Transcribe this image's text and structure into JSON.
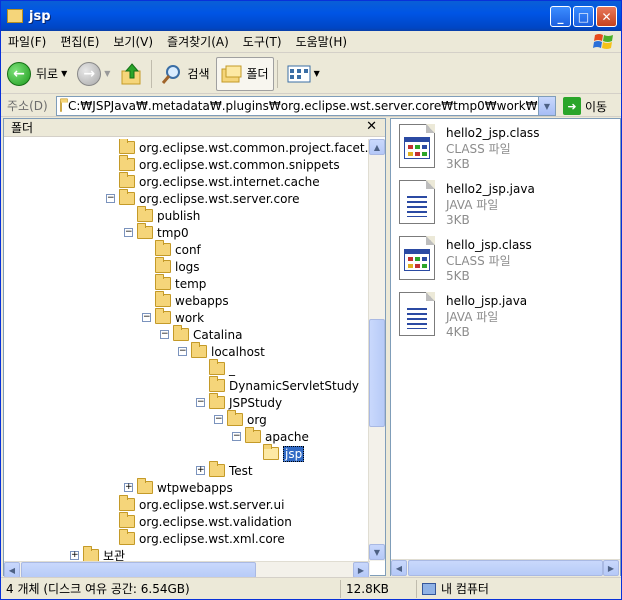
{
  "window": {
    "title": "jsp",
    "minimize": "_",
    "maximize": "□",
    "close": "✕"
  },
  "menu": [
    "파일(F)",
    "편집(E)",
    "보기(V)",
    "즐겨찾기(A)",
    "도구(T)",
    "도움말(H)"
  ],
  "toolbar": {
    "back": "뒤로",
    "search": "검색",
    "folders": "폴더"
  },
  "address": {
    "label": "주소(D)",
    "value": "C:₩JSPJava₩.metadata₩.plugins₩org.eclipse.wst.server.core₩tmp0₩work₩Catalina₩localhost₩JSPStudy₩org₩apache₩jsp",
    "go": "이동"
  },
  "folder_pane": {
    "title": "폴더",
    "close": "✕"
  },
  "tree": [
    {
      "label": "org.eclipse.wst.common.project.facet.ui",
      "level": 0,
      "toggle": "",
      "open": false,
      "selected": false
    },
    {
      "label": "org.eclipse.wst.common.snippets",
      "level": 0,
      "toggle": "",
      "open": false,
      "selected": false
    },
    {
      "label": "org.eclipse.wst.internet.cache",
      "level": 0,
      "toggle": "",
      "open": false,
      "selected": false
    },
    {
      "label": "org.eclipse.wst.server.core",
      "level": 0,
      "toggle": "−",
      "open": false,
      "selected": false
    },
    {
      "label": "publish",
      "level": 1,
      "toggle": "",
      "open": false,
      "selected": false
    },
    {
      "label": "tmp0",
      "level": 1,
      "toggle": "−",
      "open": false,
      "selected": false
    },
    {
      "label": "conf",
      "level": 2,
      "toggle": "",
      "open": false,
      "selected": false
    },
    {
      "label": "logs",
      "level": 2,
      "toggle": "",
      "open": false,
      "selected": false
    },
    {
      "label": "temp",
      "level": 2,
      "toggle": "",
      "open": false,
      "selected": false
    },
    {
      "label": "webapps",
      "level": 2,
      "toggle": "",
      "open": false,
      "selected": false
    },
    {
      "label": "work",
      "level": 2,
      "toggle": "−",
      "open": false,
      "selected": false
    },
    {
      "label": "Catalina",
      "level": 3,
      "toggle": "−",
      "open": false,
      "selected": false
    },
    {
      "label": "localhost",
      "level": 4,
      "toggle": "−",
      "open": false,
      "selected": false
    },
    {
      "label": "_",
      "level": 5,
      "toggle": "",
      "open": false,
      "selected": false
    },
    {
      "label": "DynamicServletStudy",
      "level": 5,
      "toggle": "",
      "open": false,
      "selected": false
    },
    {
      "label": "JSPStudy",
      "level": 5,
      "toggle": "−",
      "open": false,
      "selected": false
    },
    {
      "label": "org",
      "level": 6,
      "toggle": "−",
      "open": false,
      "selected": false
    },
    {
      "label": "apache",
      "level": 7,
      "toggle": "−",
      "open": false,
      "selected": false
    },
    {
      "label": "jsp",
      "level": 8,
      "toggle": "",
      "open": true,
      "selected": true
    },
    {
      "label": "Test",
      "level": 5,
      "toggle": "+",
      "open": false,
      "selected": false
    },
    {
      "label": "wtpwebapps",
      "level": 1,
      "toggle": "+",
      "open": false,
      "selected": false
    },
    {
      "label": "org.eclipse.wst.server.ui",
      "level": 0,
      "toggle": "",
      "open": false,
      "selected": false
    },
    {
      "label": "org.eclipse.wst.validation",
      "level": 0,
      "toggle": "",
      "open": false,
      "selected": false
    },
    {
      "label": "org.eclipse.wst.xml.core",
      "level": 0,
      "toggle": "",
      "open": false,
      "selected": false
    },
    {
      "label": "보관",
      "level": -2,
      "toggle": "+",
      "open": false,
      "selected": false
    }
  ],
  "files": [
    {
      "name": "hello2_jsp.class",
      "type": "CLASS 파일",
      "size": "3KB",
      "kind": "class"
    },
    {
      "name": "hello2_jsp.java",
      "type": "JAVA 파일",
      "size": "3KB",
      "kind": "java"
    },
    {
      "name": "hello_jsp.class",
      "type": "CLASS 파일",
      "size": "5KB",
      "kind": "class"
    },
    {
      "name": "hello_jsp.java",
      "type": "JAVA 파일",
      "size": "4KB",
      "kind": "java"
    }
  ],
  "status": {
    "objects": "4 개체 (디스크 여유 공간: 6.54GB)",
    "size": "12.8KB",
    "location": "내 컴퓨터"
  }
}
